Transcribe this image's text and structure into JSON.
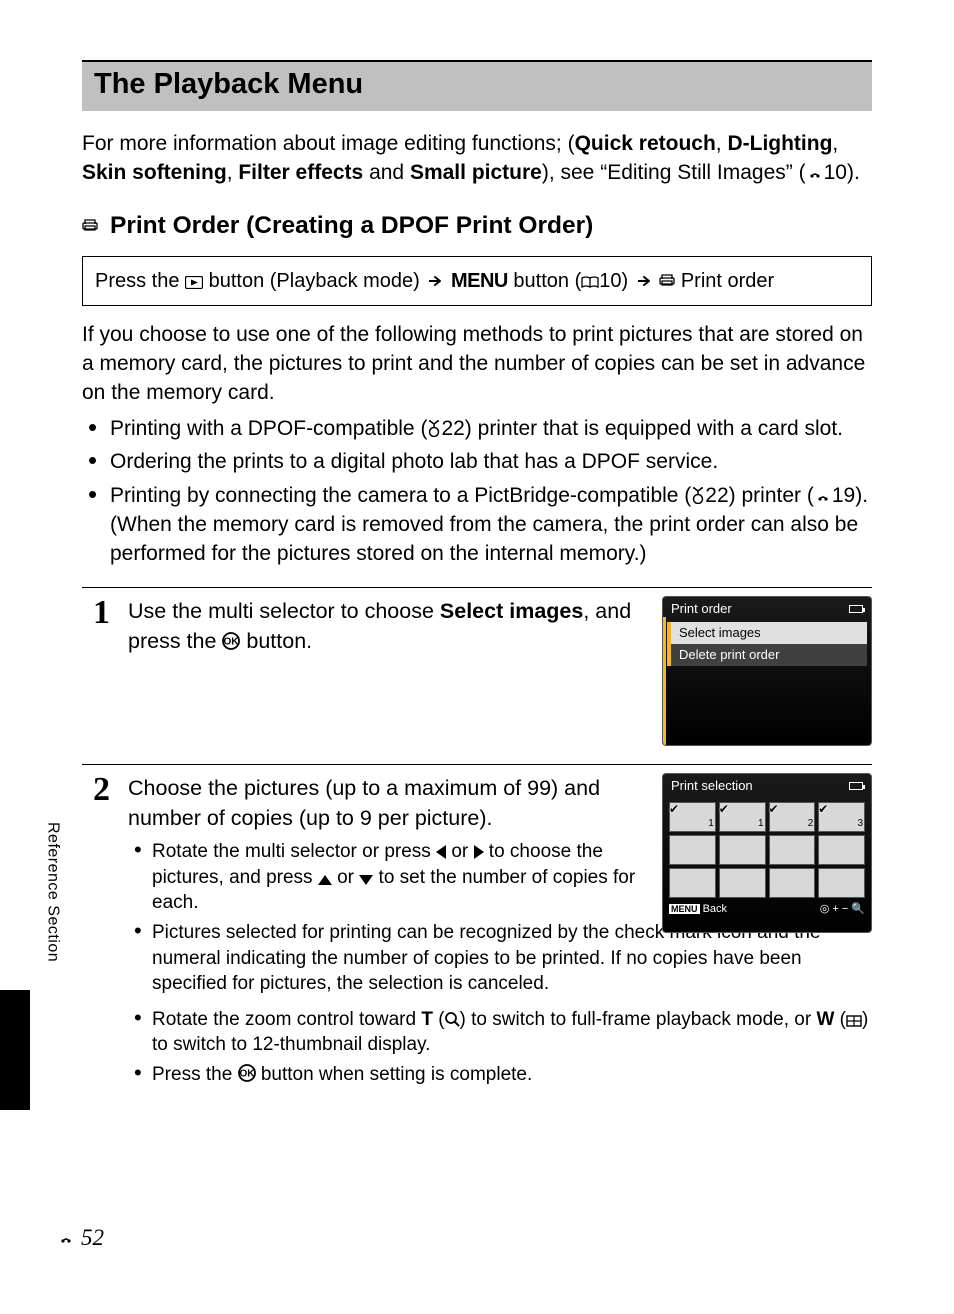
{
  "header": {
    "title": "The Playback Menu"
  },
  "intro": {
    "pre": "For more information about image editing functions; (",
    "b1": "Quick retouch",
    "s1": ", ",
    "b2": "D-Lighting",
    "s2": ", ",
    "b3": "Skin softening",
    "s3": ", ",
    "b4": "Filter effects",
    "s4": " and ",
    "b5": "Small picture",
    "post1": "), see “Editing Still Images” (",
    "ref1": "10).",
    "full_post": ")"
  },
  "subhead": {
    "title": "Print Order (Creating a DPOF Print Order)"
  },
  "nav": {
    "t1": "Press the ",
    "t2": " button (Playback mode) ",
    "t3": " ",
    "menu": "MENU",
    "t4": " button (",
    "ref": "10) ",
    "t5": " ",
    "t6": " Print order"
  },
  "body1": "If you choose to use one of the following methods to print pictures that are stored on a memory card, the pictures to print and the number of copies can be set in advance on the memory card.",
  "bullets": {
    "b1a": "Printing with a DPOF-compatible (",
    "b1b": "22) printer that is equipped with a card slot.",
    "b2": "Ordering the prints to a digital photo lab that has a DPOF service.",
    "b3a": "Printing by connecting the camera to a PictBridge-compatible (",
    "b3b": "22) printer (",
    "b3c": "19). (When the memory card is removed from the camera, the print order can also be performed for the pictures stored on the internal memory.)"
  },
  "step1": {
    "num": "1",
    "t1": "Use the multi selector to choose ",
    "b1": "Select images",
    "t2": ", and press the ",
    "t3": " button."
  },
  "lcd1": {
    "title": "Print order",
    "item_selected": "Select images",
    "item2": "Delete print order"
  },
  "step2": {
    "num": "2",
    "title": "Choose the pictures (up to a maximum of 99) and number of copies (up to 9 per picture).",
    "s1a": "Rotate the multi selector or press ",
    "s1b": " or ",
    "s1c": " to choose the pictures, and press ",
    "s1d": " or ",
    "s1e": " to set the number of copies for each.",
    "s2": "Pictures selected for printing can be recognized by the check mark icon and the numeral indicating the number of copies to be printed. If no copies have been specified for pictures, the selection is canceled.",
    "s3a": "Rotate the zoom control toward ",
    "s3T": "T",
    "s3b": " (",
    "s3c": ") to switch to full-frame playback mode, or ",
    "s3W": "W",
    "s3d": " (",
    "s3e": ") to switch to 12-thumbnail display.",
    "s4a": "Press the ",
    "s4b": " button when setting is complete."
  },
  "lcd2": {
    "title": "Print selection",
    "back": "Back",
    "thumbs": [
      {
        "check": true,
        "num": "1"
      },
      {
        "check": true,
        "num": "1"
      },
      {
        "check": true,
        "num": "2"
      },
      {
        "check": true,
        "num": "3"
      },
      {
        "check": false
      },
      {
        "check": false
      },
      {
        "check": false
      },
      {
        "check": false
      },
      {
        "check": false
      },
      {
        "check": false
      },
      {
        "check": false
      },
      {
        "check": false
      }
    ]
  },
  "side": {
    "label": "Reference Section"
  },
  "footer": {
    "page": "52"
  }
}
